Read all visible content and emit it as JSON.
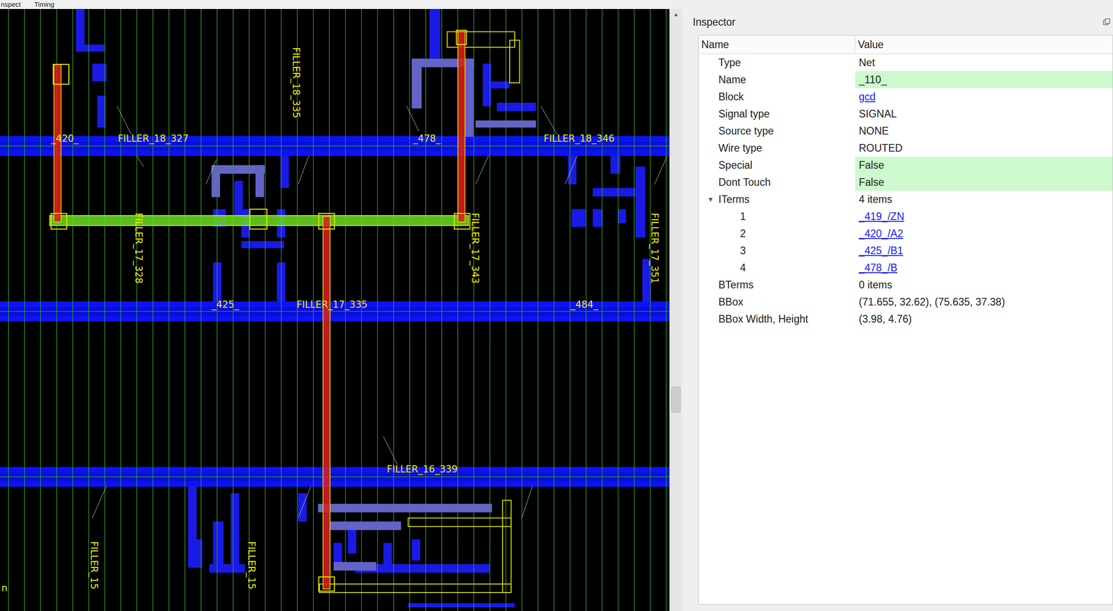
{
  "menu": [
    {
      "label": "nspect",
      "selected": false
    },
    {
      "label": "Timing",
      "selected": false
    }
  ],
  "canvas": {
    "labels": [
      {
        "text": "_420_",
        "vertical": false
      },
      {
        "text": "FILLER_18_327",
        "vertical": false
      },
      {
        "text": "FILLER_18_335",
        "vertical": true
      },
      {
        "text": "_478_",
        "vertical": false
      },
      {
        "text": "FILLER_18_346",
        "vertical": false
      },
      {
        "text": "FILLER_17_328",
        "vertical": true
      },
      {
        "text": "_425_",
        "vertical": false
      },
      {
        "text": "FILLER_17_335",
        "vertical": false
      },
      {
        "text": "FILLER_17_343",
        "vertical": true
      },
      {
        "text": "_484_",
        "vertical": false
      },
      {
        "text": "FILLER_17_351",
        "vertical": true
      },
      {
        "text": "FILLER_16_339",
        "vertical": false
      },
      {
        "text": "FILLER_15",
        "vertical": true
      },
      {
        "text": "FILLER_15",
        "vertical": true
      },
      {
        "text": "n",
        "vertical": false
      }
    ]
  },
  "scrollbar": {
    "up": "▲",
    "level": 0.62
  },
  "inspector": {
    "title": "Inspector",
    "columns": [
      "Name",
      "Value"
    ],
    "rows": [
      {
        "name": "Type",
        "value": "Net",
        "depth": 0,
        "link": false,
        "highlighted": false
      },
      {
        "name": "Name",
        "value": "_110_",
        "depth": 0,
        "link": false,
        "highlighted": true
      },
      {
        "name": "Block",
        "value": "gcd",
        "depth": 0,
        "link": true,
        "highlighted": false
      },
      {
        "name": "Signal type",
        "value": "SIGNAL",
        "depth": 0,
        "link": false,
        "highlighted": false
      },
      {
        "name": "Source type",
        "value": "NONE",
        "depth": 0,
        "link": false,
        "highlighted": false
      },
      {
        "name": "Wire type",
        "value": "ROUTED",
        "depth": 0,
        "link": false,
        "highlighted": false
      },
      {
        "name": "Special",
        "value": "False",
        "depth": 0,
        "link": false,
        "highlighted": true
      },
      {
        "name": "Dont Touch",
        "value": "False",
        "depth": 0,
        "link": false,
        "highlighted": true
      },
      {
        "name": "ITerms",
        "value": "4 items",
        "depth": 0,
        "link": false,
        "highlighted": false,
        "toggle": "▾",
        "expanded": true
      },
      {
        "name": "1",
        "value": "_419_/ZN",
        "depth": 1,
        "link": true,
        "highlighted": false
      },
      {
        "name": "2",
        "value": "_420_/A2",
        "depth": 1,
        "link": true,
        "highlighted": false
      },
      {
        "name": "3",
        "value": "_425_/B1",
        "depth": 1,
        "link": true,
        "highlighted": false
      },
      {
        "name": "4",
        "value": "_478_/B",
        "depth": 1,
        "link": true,
        "highlighted": false
      },
      {
        "name": "BTerms",
        "value": "0 items",
        "depth": 0,
        "link": false,
        "highlighted": false
      },
      {
        "name": "BBox",
        "value": "(71.655, 32.62), (75.635, 37.38)",
        "depth": 0,
        "link": false,
        "highlighted": false
      },
      {
        "name": "BBox Width, Height",
        "value": "(3.98, 4.76)",
        "depth": 0,
        "link": false,
        "highlighted": false
      }
    ]
  }
}
